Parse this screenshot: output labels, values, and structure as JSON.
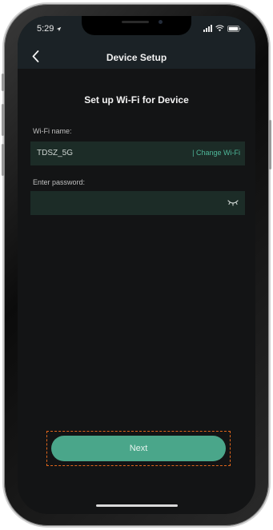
{
  "status_bar": {
    "time": "5:29"
  },
  "nav": {
    "title": "Device Setup"
  },
  "main": {
    "section_title": "Set up Wi-Fi for Device",
    "wifi": {
      "label": "Wi-Fi name:",
      "value": "TDSZ_5G",
      "change_link": "| Change Wi-Fi"
    },
    "password": {
      "label": "Enter password:",
      "value": "",
      "placeholder": ""
    },
    "next_label": "Next"
  },
  "colors": {
    "accent": "#4aa68a",
    "link": "#4fb89a",
    "field_bg": "#1c2c27",
    "screen_bg": "#131415",
    "highlight": "#e0661c"
  },
  "icons": {
    "back": "chevron-left-icon",
    "eye": "eye-closed-icon",
    "location": "location-arrow-icon",
    "signal": "signal-icon",
    "wifi": "wifi-icon",
    "battery": "battery-icon"
  }
}
